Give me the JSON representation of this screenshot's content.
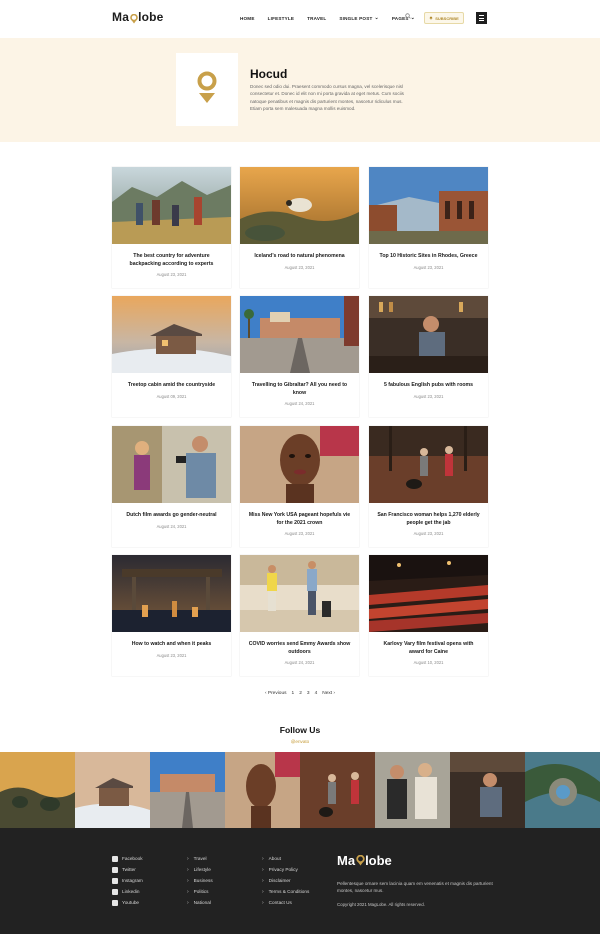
{
  "header": {
    "logo_pre": "Ma",
    "logo_post": "lobe",
    "nav": [
      "HOME",
      "LIFESTYLE",
      "TRAVEL",
      "SINGLE POST",
      "PAGES"
    ],
    "subscribe_label": "SUBSCRIBE",
    "accent": "#c8a04a"
  },
  "hero": {
    "title": "Hocud",
    "description": "Donec sed odio dui. Praesent commodo cursus magna, vel scelerisque nisl consectetur et. Donec id elit non mi porta gravida at eget metus. Cum sociis natoque penatibus et magnis dis parturient montes, nascetur ridiculus mus. Etiam porta sem malesuada magna mollis euismod.",
    "background": "#fcf4e6"
  },
  "posts": [
    {
      "title": "The best country for adventure backpacking according to experts",
      "date": "August 23, 2021"
    },
    {
      "title": "Iceland’s road to natural phenomena",
      "date": "August 23, 2021"
    },
    {
      "title": "Top 10 Historic Sites in Rhodes, Greece",
      "date": "August 23, 2021"
    },
    {
      "title": "Treetop cabin amid the countryside",
      "date": "August 09, 2021"
    },
    {
      "title": "Travelling to Gibraltar? All you need to know",
      "date": "August 24, 2021"
    },
    {
      "title": "5 fabulous English pubs with rooms",
      "date": "August 23, 2021"
    },
    {
      "title": "Dutch film awards go gender-neutral",
      "date": "August 24, 2021"
    },
    {
      "title": "Miss New York USA pageant hopefuls vie for the 2021 crown",
      "date": "August 23, 2021"
    },
    {
      "title": "San Francisco woman helps 1,270 elderly people get the jab",
      "date": "August 23, 2021"
    },
    {
      "title": "How to watch and when it peaks",
      "date": "August 23, 2021"
    },
    {
      "title": "COVID worries send Emmy Awards show outdoors",
      "date": "August 24, 2021"
    },
    {
      "title": "Karlovy Vary film festival opens with award for Caine",
      "date": "August 10, 2021"
    }
  ],
  "pagination": {
    "prev": "‹ Previous",
    "pages": [
      "1",
      "2",
      "3",
      "4"
    ],
    "next": "Next ›"
  },
  "follow": {
    "title": "Follow Us",
    "handle": "@envato"
  },
  "footer": {
    "social": [
      "Facebook",
      "Twitter",
      "Instagram",
      "Linkedin",
      "Youtube"
    ],
    "categories": [
      "Travel",
      "Lifestyle",
      "Business",
      "Politics",
      "National"
    ],
    "links": [
      "About",
      "Privacy Policy",
      "Disclaimer",
      "Terms & Conditions",
      "Contact Us"
    ],
    "description": "Pellentesque ornare sem lacinia quam em venenatis et magnis dis parturient montes, nascetur mus.",
    "copyright": "Copyright 2021 MagLobe. All rights reserved."
  }
}
